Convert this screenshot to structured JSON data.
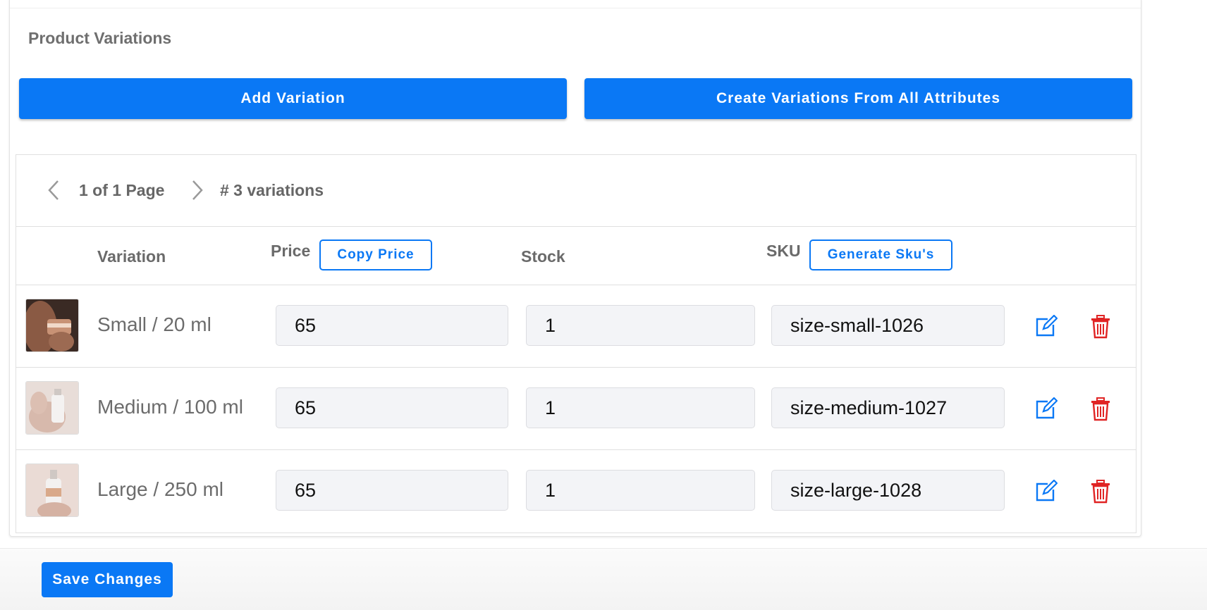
{
  "section": {
    "title": "Product Variations"
  },
  "actions": {
    "add_variation": "Add Variation",
    "create_variations": "Create Variations From All Attributes"
  },
  "pager": {
    "page_text": "1 of 1 Page",
    "count_text": "# 3 variations",
    "prev_icon": "chevron-left-icon",
    "next_icon": "chevron-right-icon"
  },
  "table": {
    "headers": {
      "variation": "Variation",
      "price": "Price",
      "copy_price": "Copy Price",
      "stock": "Stock",
      "sku": "SKU",
      "generate_skus": "Generate Sku's"
    },
    "rows": [
      {
        "name": "Small / 20 ml",
        "price": "65",
        "stock": "1",
        "sku": "size-small-1026"
      },
      {
        "name": "Medium / 100 ml",
        "price": "65",
        "stock": "1",
        "sku": "size-medium-1027"
      },
      {
        "name": "Large / 250 ml",
        "price": "65",
        "stock": "1",
        "sku": "size-large-1028"
      }
    ]
  },
  "footer": {
    "save_label": "Save Changes"
  },
  "colors": {
    "primary": "#0a78f5",
    "danger": "#e02424"
  }
}
